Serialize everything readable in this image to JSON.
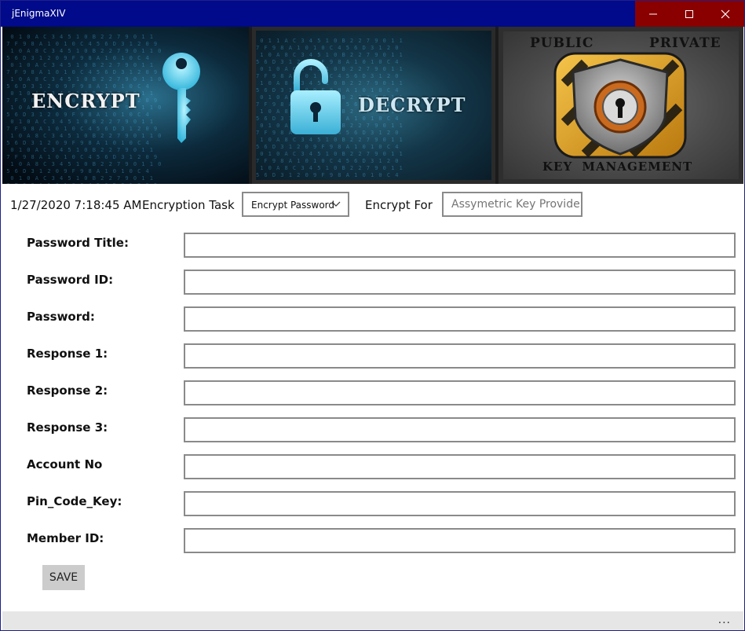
{
  "window": {
    "title": "jEnigmaXIV",
    "controls": {
      "minimize": "minimize",
      "maximize": "maximize",
      "close": "close"
    }
  },
  "banner": {
    "encrypt_label": "ENCRYPT",
    "decrypt_label": "DECRYPT",
    "public_label": "PUBLIC",
    "private_label": "PRIVATE",
    "key_management_label": "KEY MANAGEMENT"
  },
  "toolbar": {
    "datetime": "1/27/2020 7:18:45 AM",
    "task_label": "Encryption Task",
    "task_value": "Encrypt Password",
    "for_label": "Encrypt For",
    "for_placeholder": "Assymetric Key Provider"
  },
  "form": {
    "fields": [
      {
        "label": "Password Title:",
        "value": ""
      },
      {
        "label": "Password ID:",
        "value": ""
      },
      {
        "label": "Password:",
        "value": ""
      },
      {
        "label": "Response 1:",
        "value": ""
      },
      {
        "label": "Response 2:",
        "value": ""
      },
      {
        "label": "Response 3:",
        "value": ""
      },
      {
        "label": "Account No",
        "value": ""
      },
      {
        "label": "Pin_Code_Key:",
        "value": ""
      },
      {
        "label": "Member ID:",
        "value": ""
      }
    ],
    "save_label": "SAVE"
  },
  "statusbar": {
    "more_label": "..."
  },
  "colors": {
    "titlebar": "#000a8a",
    "close_area": "#8a0000",
    "accent_cyan": "#5fd4f2",
    "gold": "#e0a21a"
  }
}
